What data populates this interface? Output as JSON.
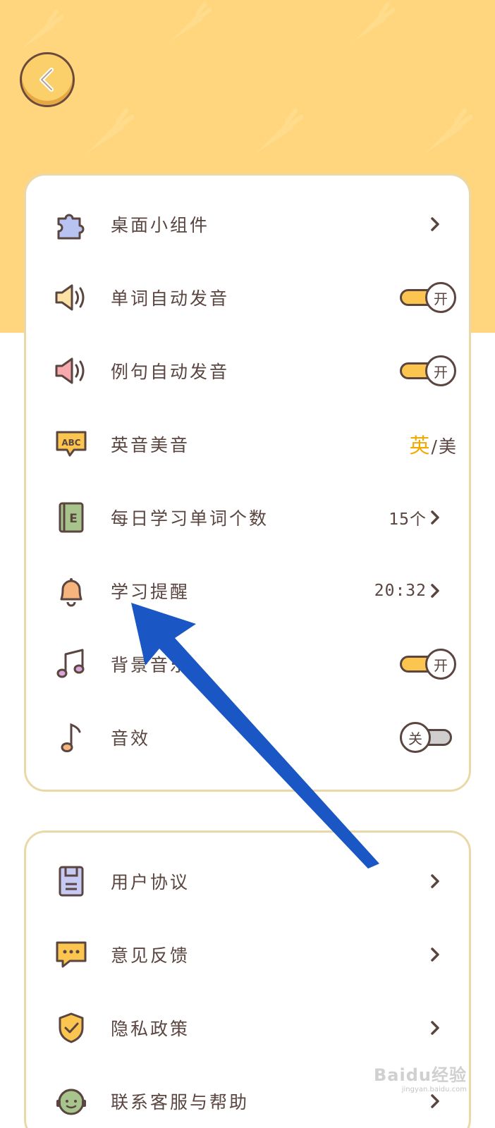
{
  "header": {
    "back_icon": "chevron-left-icon"
  },
  "settings": {
    "widget": {
      "label": "桌面小组件",
      "icon": "puzzle-icon"
    },
    "word_auto_pronounce": {
      "label": "单词自动发音",
      "icon": "speaker-icon",
      "state": "开",
      "on": true
    },
    "sentence_auto_pronounce": {
      "label": "例句自动发音",
      "icon": "speaker-icon",
      "state": "开",
      "on": true
    },
    "accent": {
      "label": "英音美音",
      "icon": "abc-bubble-icon",
      "active": "英",
      "separator": "/",
      "inactive": "美"
    },
    "daily_words": {
      "label": "每日学习单词个数",
      "icon": "book-icon",
      "value": "15个"
    },
    "study_reminder": {
      "label": "学习提醒",
      "icon": "bell-icon",
      "value": "20:32"
    },
    "background_music": {
      "label": "背景音乐",
      "icon": "music-notes-icon",
      "state": "开",
      "on": true
    },
    "sound_effects": {
      "label": "音效",
      "icon": "music-note-icon",
      "state": "关",
      "on": false
    }
  },
  "info": {
    "user_agreement": {
      "label": "用户协议",
      "icon": "document-icon"
    },
    "feedback": {
      "label": "意见反馈",
      "icon": "chat-bubble-icon"
    },
    "privacy_policy": {
      "label": "隐私政策",
      "icon": "shield-check-icon"
    },
    "contact_support": {
      "label": "联系客服与帮助",
      "icon": "headset-avatar-icon"
    }
  },
  "colors": {
    "header_bg": "#ffd57d",
    "toggle_on": "#fbc54f",
    "accent_active": "#f2a900",
    "text": "#5a4540",
    "card_border": "#e9d9a9",
    "annotation_arrow": "#1a57c4"
  },
  "watermark": {
    "brand": "Baidu经验",
    "sub": "jingyan.baidu.com"
  }
}
